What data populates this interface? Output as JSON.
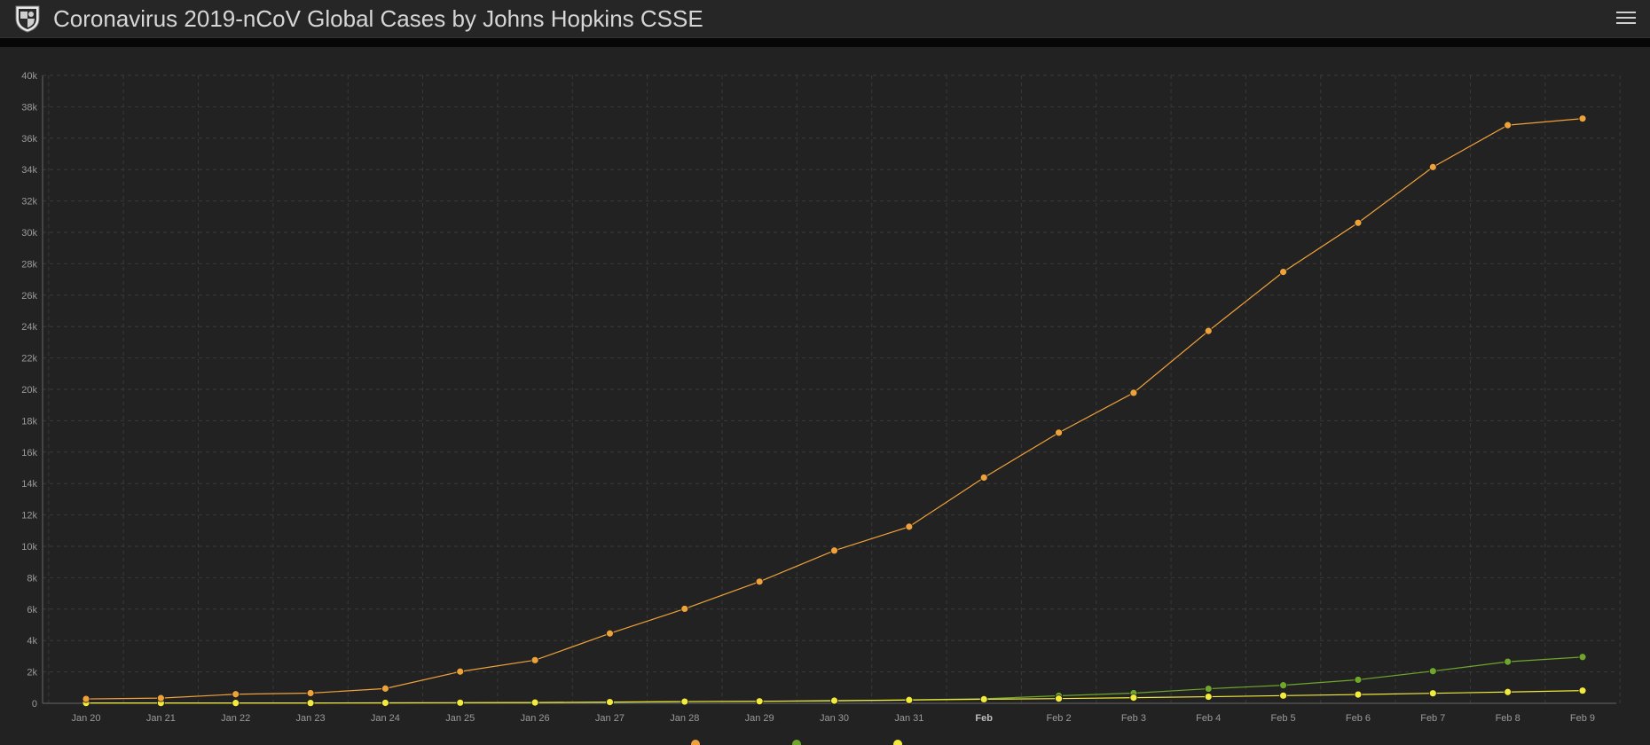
{
  "header": {
    "title": "Coronavirus 2019-nCoV Global Cases by Johns Hopkins CSSE",
    "logo_icon": "shield-logo-icon",
    "menu_icon": "hamburger-menu-icon"
  },
  "chart_data": {
    "type": "line",
    "title": "",
    "xlabel": "",
    "ylabel": "",
    "categories": [
      "Jan 20",
      "Jan 21",
      "Jan 22",
      "Jan 23",
      "Jan 24",
      "Jan 25",
      "Jan 26",
      "Jan 27",
      "Jan 28",
      "Jan 29",
      "Jan 30",
      "Jan 31",
      "Feb",
      "Feb 2",
      "Feb 3",
      "Feb 4",
      "Feb 5",
      "Feb 6",
      "Feb 7",
      "Feb 8",
      "Feb 9"
    ],
    "bold_categories": [
      "Feb"
    ],
    "ylim": [
      0,
      40000
    ],
    "yticks": [
      0,
      2000,
      4000,
      6000,
      8000,
      10000,
      12000,
      14000,
      16000,
      18000,
      20000,
      22000,
      24000,
      26000,
      28000,
      30000,
      32000,
      34000,
      36000,
      38000,
      40000
    ],
    "ytick_labels": [
      "0",
      "2k",
      "4k",
      "6k",
      "8k",
      "10k",
      "12k",
      "14k",
      "16k",
      "18k",
      "20k",
      "22k",
      "24k",
      "26k",
      "28k",
      "30k",
      "32k",
      "34k",
      "36k",
      "38k",
      "40k"
    ],
    "grid": true,
    "series": [
      {
        "color": "#f0a23a",
        "values": [
          280,
          330,
          580,
          650,
          940,
          2020,
          2750,
          4450,
          6020,
          7750,
          9730,
          11250,
          14380,
          17240,
          19780,
          23720,
          27480,
          30610,
          34160,
          36830,
          37250
        ]
      },
      {
        "color": "#6fa62c",
        "values": null,
        "values_from": 4,
        "values_list": [
          40,
          50,
          60,
          110,
          130,
          150,
          220,
          290,
          480,
          650,
          930,
          1150,
          1500,
          2050,
          2650,
          2950
        ],
        "values_start": 5
      },
      {
        "color": "#f2ea3c",
        "values": [
          20,
          20,
          20,
          20,
          30,
          40,
          50,
          80,
          110,
          130,
          170,
          210,
          260,
          300,
          360,
          420,
          490,
          560,
          640,
          720,
          810
        ]
      }
    ]
  }
}
